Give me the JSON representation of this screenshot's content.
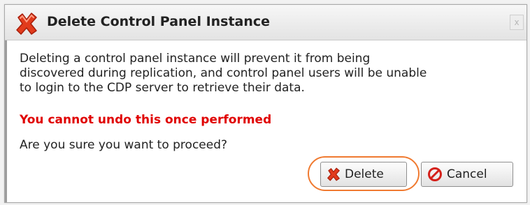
{
  "dialog": {
    "title": "Delete Control Panel Instance",
    "title_icon": "red-x-icon",
    "close_label": "x",
    "message_lines": [
      "Deleting a control panel instance will prevent it from being",
      "discovered during replication, and control panel users will be unable",
      "to login to the CDP server to retrieve their data."
    ],
    "warning": "You cannot undo this once performed",
    "question": "Are you sure you want to proceed?",
    "warning_color": "#e00000"
  },
  "buttons": {
    "delete_label": "Delete",
    "delete_icon": "red-x-icon",
    "cancel_label": "Cancel",
    "cancel_icon": "no-entry-icon"
  },
  "annotation": {
    "highlight_color": "#f07a30"
  }
}
